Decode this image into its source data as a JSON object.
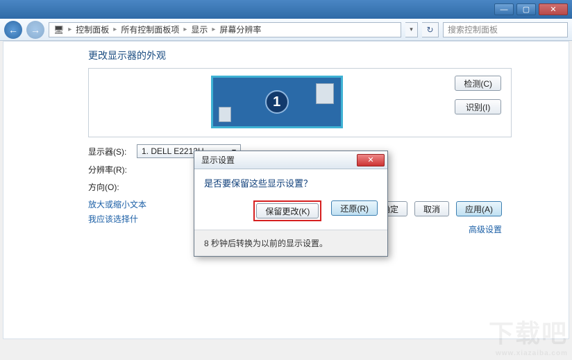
{
  "breadcrumb": {
    "seg0": "控制面板",
    "seg1": "所有控制面板项",
    "seg2": "显示",
    "seg3": "屏幕分辨率"
  },
  "search": {
    "placeholder": "搜索控制面板"
  },
  "page": {
    "title": "更改显示器的外观"
  },
  "preview": {
    "detect_btn": "检测(C)",
    "identify_btn": "识别(I)",
    "monitor_number": "1"
  },
  "form": {
    "display_label": "显示器(S):",
    "display_value": "1. DELL E2213H",
    "resolution_label": "分辨率(R):",
    "orientation_label": "方向(O):"
  },
  "links": {
    "text_size": "放大或缩小文本",
    "what_choose": "我应该选择什",
    "advanced": "高级设置"
  },
  "footer": {
    "ok": "确定",
    "cancel": "取消",
    "apply": "应用(A)"
  },
  "dialog": {
    "title": "显示设置",
    "question": "是否要保留这些显示设置？",
    "keep_btn": "保留更改(K)",
    "revert_btn": "还原(R)",
    "countdown": "8 秒钟后转换为以前的显示设置。"
  },
  "watermark": {
    "big": "下载吧",
    "url": "www.xiazaiba.com"
  }
}
